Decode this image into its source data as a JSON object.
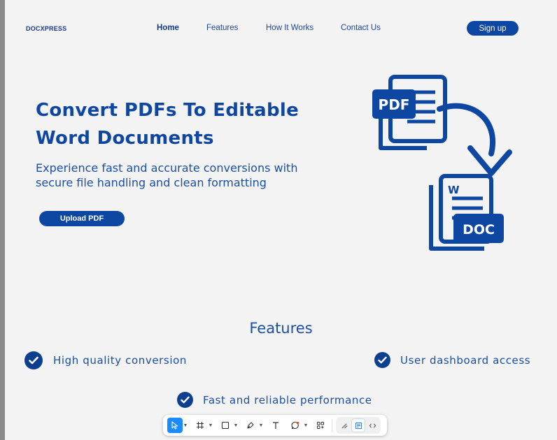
{
  "nav": {
    "logo": "DOCXPRESS",
    "links": [
      "Home",
      "Features",
      "How It Works",
      "Contact Us"
    ],
    "signup_label": "Sign up"
  },
  "hero": {
    "title_line1": "Convert PDFs To Editable",
    "title_line2": "Word Documents",
    "subtitle_line1": "Experience fast and accurate conversions with",
    "subtitle_line2": "secure file handling and clean formatting",
    "upload_label": "Upload PDF"
  },
  "illustration": {
    "pdf_label": "PDF",
    "doc_label": "DOC",
    "word_letter": "W"
  },
  "features": {
    "heading": "Features",
    "items": [
      "High quality conversion",
      "User dashboard access",
      "Fast and reliable performance"
    ]
  },
  "toolbar": {
    "tools": [
      "move-tool",
      "frame-tool",
      "shape-tool",
      "pen-tool",
      "text-tool",
      "comment-tool",
      "actions-tool"
    ],
    "modes": [
      "draw-mode",
      "design-mode",
      "dev-mode"
    ]
  },
  "colors": {
    "brand": "#0d47a1",
    "text": "#1b4fa3",
    "background": "#f3f3f3"
  }
}
